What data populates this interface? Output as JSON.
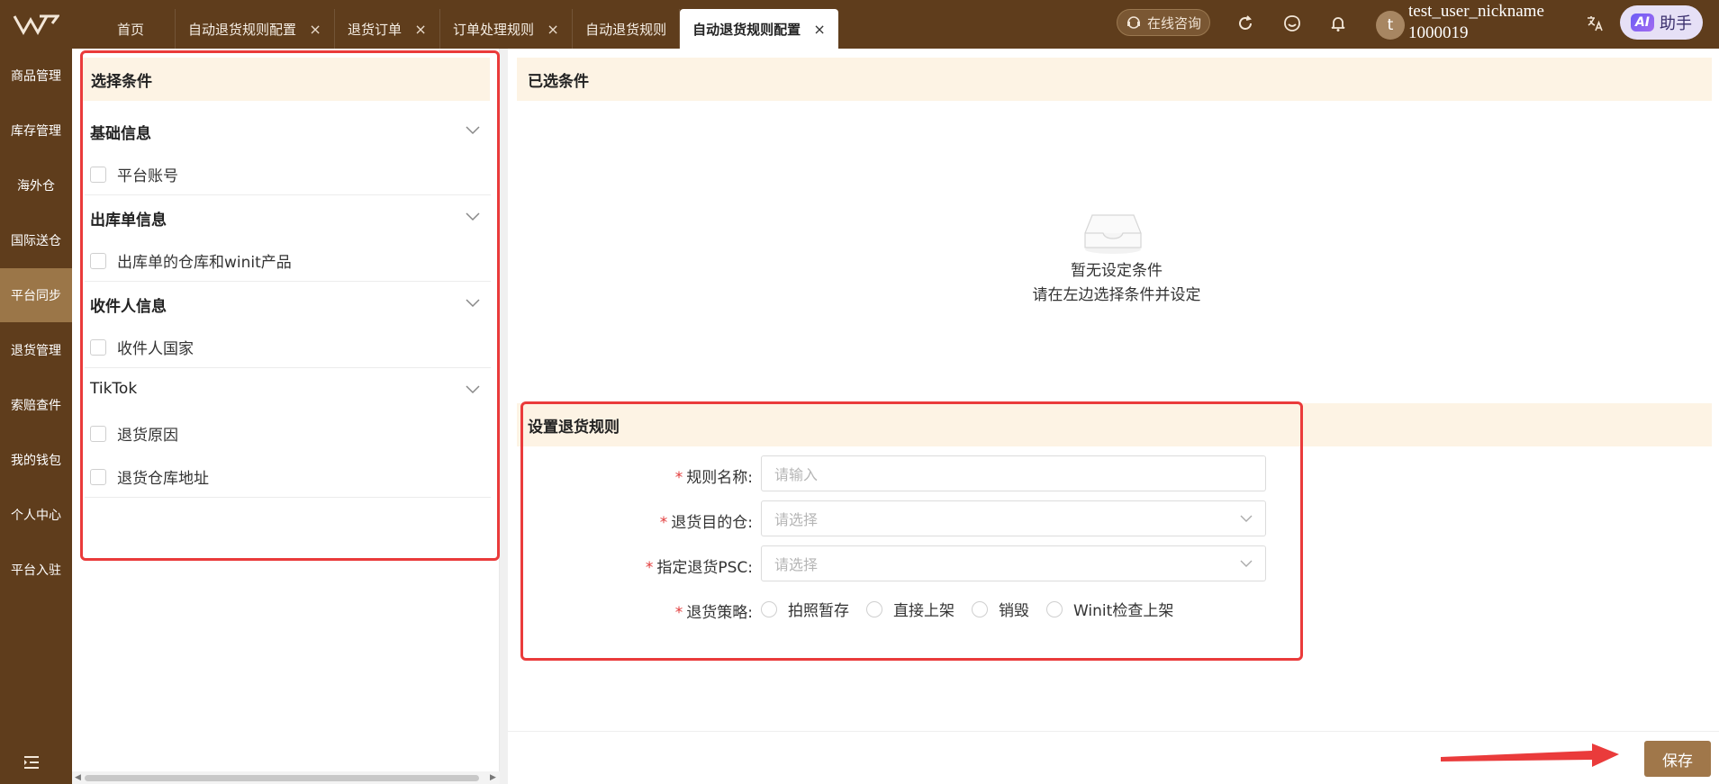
{
  "header": {
    "tabs": [
      {
        "label": "首页",
        "closable": false,
        "active": false
      },
      {
        "label": "自动退货规则配置",
        "closable": true,
        "active": false
      },
      {
        "label": "退货订单",
        "closable": true,
        "active": false
      },
      {
        "label": "订单处理规则",
        "closable": true,
        "active": false
      },
      {
        "label": "自动退货规则",
        "closable": false,
        "active": false
      },
      {
        "label": "自动退货规则配置",
        "closable": true,
        "active": true
      }
    ],
    "close_glyph": "×",
    "consult_label": "在线咨询",
    "user": {
      "avatar_letter": "t",
      "nickname": "test_user_nickname",
      "id": "1000019"
    },
    "ai_badge": "AI",
    "ai_label": "助手"
  },
  "sidebar": {
    "items": [
      "商品管理",
      "库存管理",
      "海外仓",
      "国际送仓",
      "平台同步",
      "退货管理",
      "索赔查件",
      "我的钱包",
      "个人中心",
      "平台入驻"
    ],
    "active_index": 4
  },
  "left_panel": {
    "title": "选择条件",
    "groups": [
      {
        "title": "基础信息",
        "options": [
          "平台账号"
        ]
      },
      {
        "title": "出库单信息",
        "options": [
          "出库单的仓库和winit产品"
        ]
      },
      {
        "title": "收件人信息",
        "options": [
          "收件人国家"
        ]
      },
      {
        "title": "TikTok",
        "options": [
          "退货原因",
          "退货仓库地址"
        ]
      }
    ]
  },
  "selected_panel": {
    "title": "已选条件",
    "empty_line1": "暂无设定条件",
    "empty_line2": "请在左边选择条件并设定"
  },
  "rule_form": {
    "title": "设置退货规则",
    "required_mark": "*",
    "name_label": "规则名称:",
    "name_placeholder": "请输入",
    "warehouse_label": "退货目的仓:",
    "warehouse_placeholder": "请选择",
    "psc_label": "指定退货PSC:",
    "psc_placeholder": "请选择",
    "strategy_label": "退货策略:",
    "strategies": [
      "拍照暂存",
      "直接上架",
      "销毁",
      "Winit检查上架"
    ]
  },
  "footer": {
    "save_label": "保存"
  },
  "colors": {
    "brand": "#5f3d1c",
    "accent": "#a0774a",
    "highlight": "#ea3b3b",
    "header_bg": "#fdf3e4"
  }
}
